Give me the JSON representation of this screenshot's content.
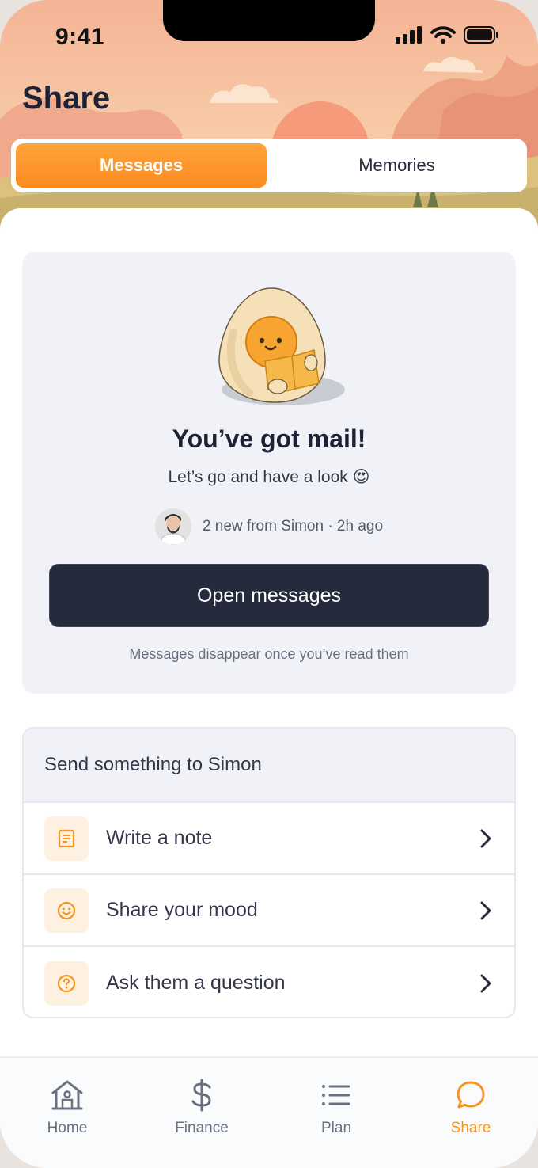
{
  "status_bar": {
    "time": "9:41"
  },
  "header": {
    "title": "Share"
  },
  "tabs": [
    {
      "label": "Messages",
      "active": true
    },
    {
      "label": "Memories",
      "active": false
    }
  ],
  "mail_card": {
    "title": "You’ve got mail!",
    "subtitle": "Let’s go and have a look 😍",
    "sender_info": "2 new from Simon · 2h ago",
    "open_button": "Open messages",
    "note": "Messages disappear once you’ve read them"
  },
  "send_card": {
    "heading": "Send something to Simon",
    "items": [
      {
        "label": "Write a note",
        "icon": "note-icon"
      },
      {
        "label": "Share your mood",
        "icon": "smiley-icon"
      },
      {
        "label": "Ask them a question",
        "icon": "question-icon"
      }
    ]
  },
  "nav": [
    {
      "label": "Home",
      "icon": "home-icon",
      "active": false
    },
    {
      "label": "Finance",
      "icon": "dollar-icon",
      "active": false
    },
    {
      "label": "Plan",
      "icon": "list-icon",
      "active": false
    },
    {
      "label": "Share",
      "icon": "chat-bubble-icon",
      "active": true
    }
  ],
  "colors": {
    "accent": "#f7941d",
    "dark_button": "#262a3d",
    "card_bg": "#f0f2f7"
  }
}
